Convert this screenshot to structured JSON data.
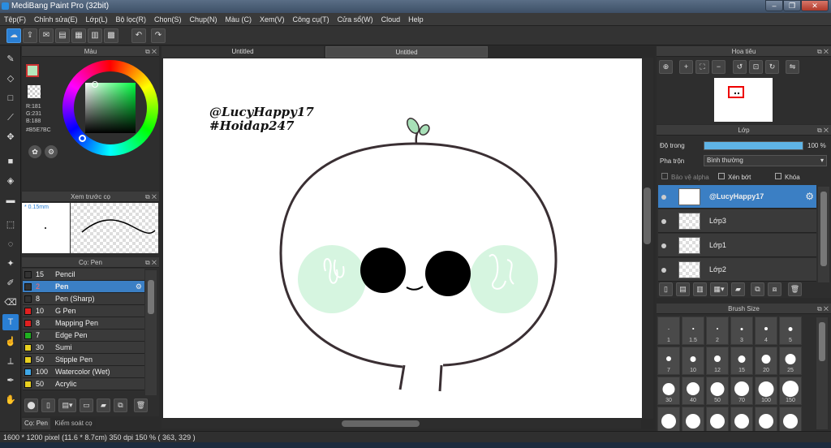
{
  "window": {
    "title": "MediBang Paint Pro (32bit)",
    "min": "–",
    "max": "❐",
    "close": "✕"
  },
  "menu": [
    "Tệp(F)",
    "Chỉnh sửa(E)",
    "Lớp(L)",
    "Bộ lọc(R)",
    "Chọn(S)",
    "Chụp(N)",
    "Màu (C)",
    "Xem(V)",
    "Công cụ(T)",
    "Cửa sổ(W)",
    "Cloud",
    "Help"
  ],
  "color_panel": {
    "title": "Màu",
    "r": "R:181",
    "g": "G:231",
    "b": "B:188",
    "hex": "#B5E7BC",
    "fg_color": "#B5E7BC"
  },
  "preview_panel": {
    "title": "Xem trước cọ",
    "size": "* 0.15mm"
  },
  "brush_panel": {
    "title": "Cọ: Pen",
    "brushes": [
      {
        "size": "15",
        "name": "Pencil",
        "color": "#333333"
      },
      {
        "size": "2",
        "name": "Pen",
        "color": "#333333"
      },
      {
        "size": "8",
        "name": "Pen (Sharp)",
        "color": "#333333"
      },
      {
        "size": "10",
        "name": "G Pen",
        "color": "#e02020"
      },
      {
        "size": "8",
        "name": "Mapping Pen",
        "color": "#e02020"
      },
      {
        "size": "7",
        "name": "Edge Pen",
        "color": "#20b020"
      },
      {
        "size": "30",
        "name": "Sumi",
        "color": "#e8d020"
      },
      {
        "size": "50",
        "name": "Stipple Pen",
        "color": "#e8d020"
      },
      {
        "size": "100",
        "name": "Watercolor (Wet)",
        "color": "#40a8e8"
      },
      {
        "size": "50",
        "name": "Acrylic",
        "color": "#e8d020"
      }
    ],
    "tabs": [
      "Cọ: Pen",
      "Kiểm soát cọ"
    ]
  },
  "document_tabs": [
    "Untitled",
    "Untitled"
  ],
  "canvas_text": [
    "@LucyHappy17",
    "#Hoidap247"
  ],
  "navigator": {
    "title": "Hoa tiêu"
  },
  "layers": {
    "title": "Lớp",
    "opacity_label": "Độ trong",
    "opacity_value": 100,
    "opacity_text": "100 %",
    "blend_label": "Pha trộn",
    "blend_value": "Bình thường",
    "protect_alpha": "Bảo vệ alpha",
    "clipping": "Xén bớt",
    "lock": "Khóa",
    "items": [
      "@LucyHappy17",
      "Lớp3",
      "Lớp1",
      "Lớp2"
    ]
  },
  "brush_size": {
    "title": "Brush Size",
    "sizes": [
      "1",
      "1.5",
      "2",
      "3",
      "4",
      "5",
      "7",
      "10",
      "12",
      "15",
      "20",
      "25",
      "30",
      "40",
      "50",
      "70",
      "100",
      "150",
      "",
      "",
      "",
      "",
      "",
      ""
    ]
  },
  "status": {
    "pixels": "1600 * 1200 pixel",
    "physical": "(11.6 * 8.7cm)",
    "dpi": "350 dpi",
    "zoom": "150 %",
    "coords": "( 363, 329 )"
  },
  "icons": {
    "toolbar": [
      "cloud-icon",
      "share-icon",
      "comment-icon",
      "page-icon",
      "document-icon",
      "grid-icon",
      "tiles-icon",
      "undo-icon",
      "redo-icon"
    ]
  }
}
